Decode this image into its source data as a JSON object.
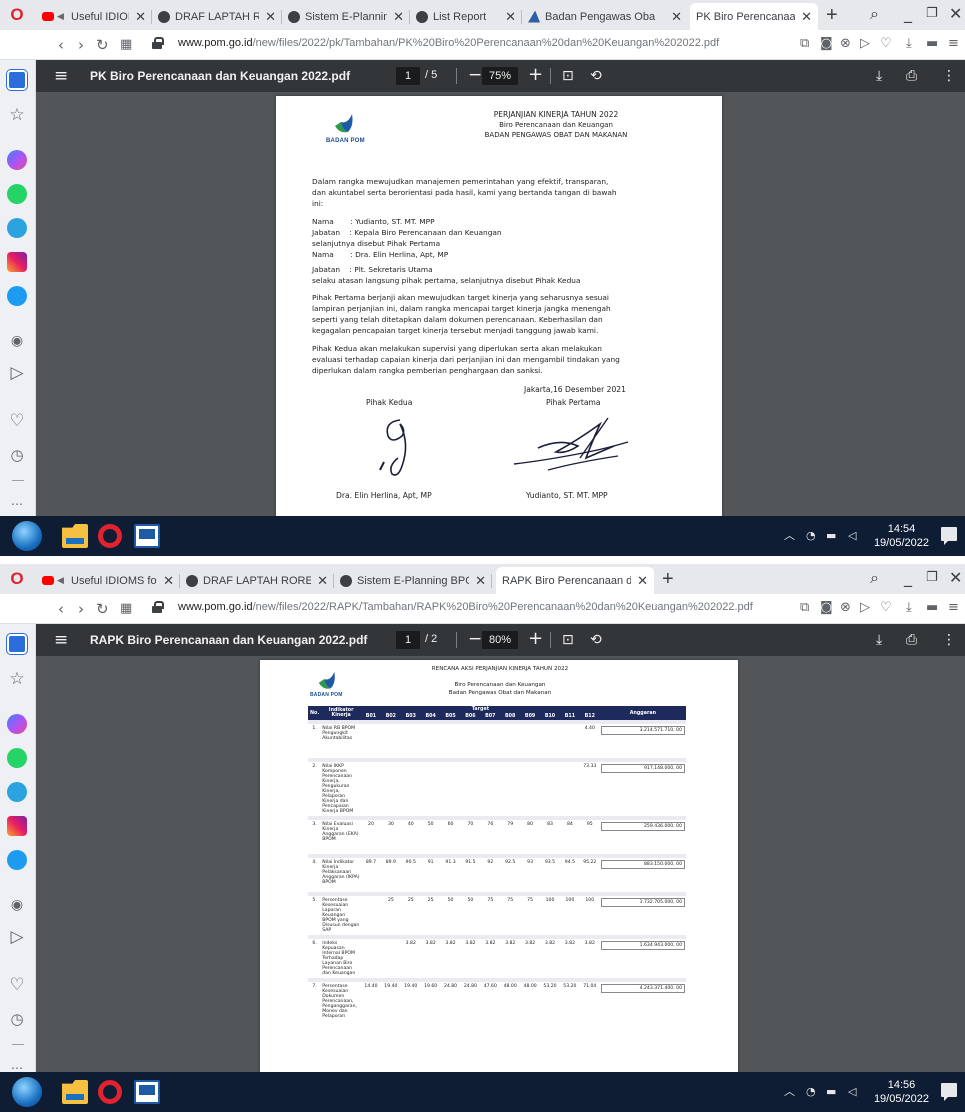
{
  "colors": {
    "tabbar_bg": "#e6e8ec",
    "pdf_toolbar_bg": "#323639",
    "viewer_bg": "#525659",
    "taskbar_bg": "#0e1c34",
    "brand_red": "#e0232f",
    "table_header_bg": "#1f2a5c"
  },
  "screens": [
    {
      "tabs": [
        {
          "label": "Useful IDIOMS fo",
          "icon": "youtube-icon"
        },
        {
          "label": "DRAF LAPTAH RORENI",
          "icon": "globe-icon"
        },
        {
          "label": "Sistem E-Planning BP",
          "icon": "globe-icon"
        },
        {
          "label": "List Report",
          "icon": "globe-icon"
        },
        {
          "label": "Badan Pengawas Oba",
          "icon": "bpom-icon"
        },
        {
          "label": "PK Biro Perencanaan",
          "icon": "none",
          "active": true
        }
      ],
      "url_host": "www.pom.go.id",
      "url_path": "/new/files/2022/pk/Tambahan/PK%20Biro%20Perencanaan%20dan%20Keuangan%202022.pdf",
      "pdf": {
        "title": "PK Biro Perencanaan dan Keuangan 2022.pdf",
        "page": "1",
        "total": "/ 5",
        "zoom": "75%"
      },
      "clock": {
        "time": "14:54",
        "date": "19/05/2022"
      }
    },
    {
      "tabs": [
        {
          "label": "Useful IDIOMS for Any",
          "icon": "youtube-icon"
        },
        {
          "label": "DRAF LAPTAH RORENKEU",
          "icon": "globe-icon"
        },
        {
          "label": "Sistem E-Planning BPOM",
          "icon": "globe-icon"
        },
        {
          "label": "RAPK Biro Perencanaan da",
          "icon": "none",
          "active": true
        }
      ],
      "url_host": "www.pom.go.id",
      "url_path": "/new/files/2022/RAPK/Tambahan/RAPK%20Biro%20Perencanaan%20dan%20Keuangan%202022.pdf",
      "pdf": {
        "title": "RAPK Biro Perencanaan dan Keuangan 2022.pdf",
        "page": "1",
        "total": "/ 2",
        "zoom": "80%"
      },
      "clock": {
        "time": "14:56",
        "date": "19/05/2022"
      }
    }
  ],
  "document1": {
    "logo_text": "BADAN POM",
    "heading1": "PERJANJIAN KINERJA TAHUN 2022",
    "heading2": "Biro Perencanaan dan Keuangan",
    "heading3": "BADAN PENGAWAS OBAT DAN MAKANAN",
    "intro_lines": [
      "Dalam rangka mewujudkan manajemen pemerintahan yang efektif, transparan,",
      "dan akuntabel serta berorientasi pada hasil, kami yang bertanda tangan di bawah",
      "ini:"
    ],
    "party_lines": [
      "Nama       : Yudianto, ST. MT. MPP",
      "Jabatan    : Kepala Biro Perencanaan dan Keuangan",
      "selanjutnya disebut Pihak Pertama",
      "Nama       : Dra. Elin Herlina, Apt, MP",
      "Jabatan    : Plt. Sekretaris Utama",
      "selaku atasan langsung pihak pertama, selanjutnya disebut Pihak Kedua"
    ],
    "para2_lines": [
      "Pihak Pertama berjanji akan mewujudkan target kinerja yang seharusnya sesuai",
      "lampiran perjanjian ini, dalam rangka mencapai target kinerja jangka menengah",
      "seperti yang telah ditetapkan dalam dokumen perencanaan. Keberhasilan dan",
      "kegagalan pencapaian target kinerja tersebut menjadi tanggung jawab kami."
    ],
    "para3_lines": [
      "Pihak Kedua akan melakukan supervisi yang diperlukan serta akan melakukan",
      "evaluasi terhadap capaian kinerja dari perjanjian ini dan mengambil tindakan yang",
      "diperlukan dalam rangka pemberian penghargaan dan sanksi."
    ],
    "place_date": "Jakarta,16 Desember 2021",
    "left_role": "Pihak Kedua",
    "right_role": "Pihak Pertama",
    "left_name": "Dra. Elin Herlina, Apt, MP",
    "right_name": "Yudianto, ST. MT. MPP"
  },
  "document2": {
    "logo_text": "BADAN POM",
    "heading1": "RENCANA AKSI PERJANJIAN KINERJA TAHUN 2022",
    "heading2": "Biro Perencanaan dan Keuangan",
    "heading3": "Badan Pengawas Obat dan Makanan",
    "col_no": "No.",
    "col_indicator": "Indikator Kinerja",
    "col_target": "Target",
    "col_budget": "Anggaran",
    "months": [
      "B01",
      "B02",
      "B03",
      "B04",
      "B05",
      "B06",
      "B07",
      "B08",
      "B09",
      "B10",
      "B11",
      "B12"
    ],
    "rows": [
      {
        "no": "1.",
        "indicator": "Nilai RB BPOM Pengungkit Akuntabilitas",
        "targets": [
          "",
          "",
          "",
          "",
          "",
          "",
          "",
          "",
          "",
          "",
          "",
          "4.40"
        ],
        "budget": "3.214.571.710, 00"
      },
      {
        "no": "2.",
        "indicator": "Nilai IKKP Komponen Perencanaan Kinerja, Pengukuran Kinerja, Pelaporan Kinerja dan Pencapaian Kinerja BPOM",
        "targets": [
          "",
          "",
          "",
          "",
          "",
          "",
          "",
          "",
          "",
          "",
          "",
          "73.33"
        ],
        "budget": "917.148.000, 00"
      },
      {
        "no": "3.",
        "indicator": "Nilai Evaluasi Kinerja Anggaran (EKA) BPOM",
        "targets": [
          "20",
          "30",
          "40",
          "50",
          "60",
          "70",
          "76",
          "79",
          "80",
          "83",
          "84",
          "95"
        ],
        "budget": "259.436.000, 00"
      },
      {
        "no": "4.",
        "indicator": "Nilai Indikator Kinerja Pelaksanaan Anggaran (IKPA) BPOM",
        "targets": [
          "89.7",
          "89.9",
          "90.5",
          "91",
          "91.3",
          "91.5",
          "92",
          "92.5",
          "93",
          "93.5",
          "94.5",
          "95.22"
        ],
        "budget": "883.150.000, 00"
      },
      {
        "no": "5.",
        "indicator": "Persentase Kesesuaian Laporan Keuangan BPOM yang Disusun dengan SAP",
        "targets": [
          "",
          "25",
          "25",
          "25",
          "50",
          "50",
          "75",
          "75",
          "75",
          "100",
          "100",
          "100"
        ],
        "budget": "1.732.705.000, 00"
      },
      {
        "no": "6.",
        "indicator": "Indeks Kepuasan Internal BPOM Terhadap Layanan Biro Perencanaan dan Keuangan",
        "targets": [
          "",
          "",
          "3.82",
          "3.82",
          "3.82",
          "3.82",
          "3.82",
          "3.82",
          "3.82",
          "3.82",
          "3.82",
          "3.82"
        ],
        "budget": "1.634.943.000, 00"
      },
      {
        "no": "7.",
        "indicator": "Persentase Kesesuaian Dokumen Perencanaan, Penganggaran, Monev dan Pelaporan",
        "targets": [
          "14.40",
          "19.40",
          "19.40",
          "19.60",
          "24.80",
          "24.80",
          "47.60",
          "48.00",
          "48.00",
          "53.20",
          "53.20",
          "71.04"
        ],
        "budget": "4.243.371.400, 00"
      }
    ]
  }
}
